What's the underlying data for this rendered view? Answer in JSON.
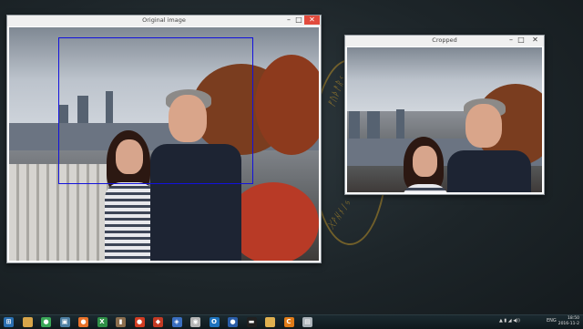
{
  "windows": {
    "original": {
      "title": "Original image"
    },
    "cropped": {
      "title": "Cropped"
    }
  },
  "window_controls": {
    "minimize": "–",
    "maximize": "□",
    "close": "✕"
  },
  "taskbar": {
    "apps": [
      {
        "icon": "start-icon",
        "color": "#2a6fb0",
        "glyph": "⊞"
      },
      {
        "icon": "folder-icon",
        "color": "#d7a54a",
        "glyph": ""
      },
      {
        "icon": "chrome-icon",
        "color": "#3aa757",
        "glyph": "●"
      },
      {
        "icon": "monitor-icon",
        "color": "#4d7fa3",
        "glyph": "▣"
      },
      {
        "icon": "firefox-icon",
        "color": "#e8722a",
        "glyph": "●"
      },
      {
        "icon": "excel-icon",
        "color": "#2f8f46",
        "glyph": "X"
      },
      {
        "icon": "media-icon",
        "color": "#8a6d4d",
        "glyph": "▮"
      },
      {
        "icon": "app-icon",
        "color": "#d03c22",
        "glyph": "●"
      },
      {
        "icon": "git-icon",
        "color": "#c33a24",
        "glyph": "◆"
      },
      {
        "icon": "cube-icon",
        "color": "#3a6ec0",
        "glyph": "◈"
      },
      {
        "icon": "app-icon-2",
        "color": "#b5b5b5",
        "glyph": "◉"
      },
      {
        "icon": "outlook-icon",
        "color": "#1e73be",
        "glyph": "O"
      },
      {
        "icon": "globe-icon",
        "color": "#2a5da8",
        "glyph": "●"
      },
      {
        "icon": "terminal-icon",
        "color": "#202020",
        "glyph": "▬"
      },
      {
        "icon": "folder-icon-2",
        "color": "#e0b050",
        "glyph": ""
      },
      {
        "icon": "c-icon",
        "color": "#e07b18",
        "glyph": "C"
      },
      {
        "icon": "window-icon",
        "color": "#aab2b8",
        "glyph": "▤"
      }
    ],
    "tray": {
      "lang": "ENG"
    },
    "clock": {
      "time": "18:50",
      "date": "2016-11-2"
    }
  }
}
